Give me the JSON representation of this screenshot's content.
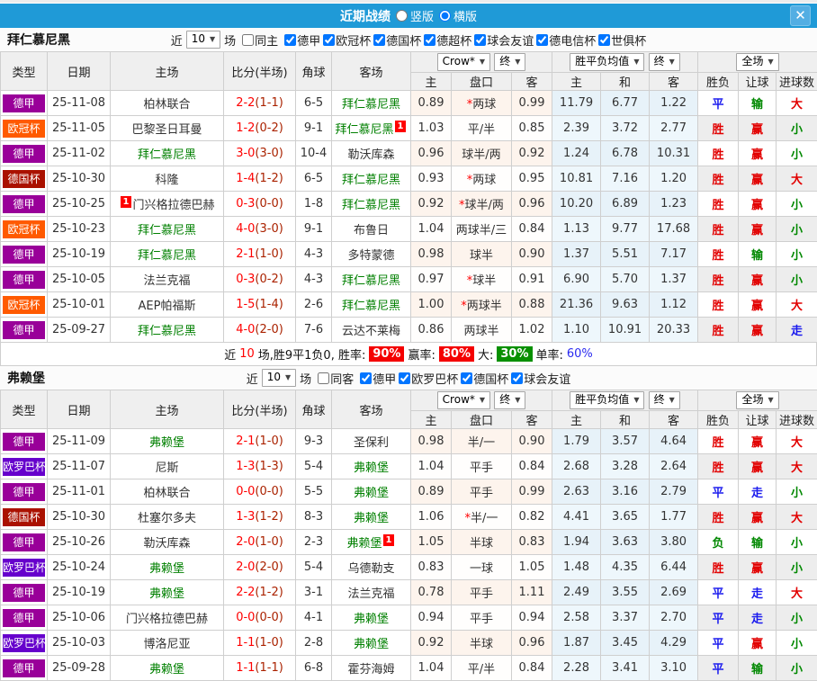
{
  "titlebar": {
    "title": "近期战绩",
    "vertical_label": "竖版",
    "horizontal_label": "横版"
  },
  "icons": {
    "caret_down": "▼",
    "close": "✕"
  },
  "accent_colors": {
    "titlebar_blue": "#1f9ad7",
    "close_button_blue": "#53aee3"
  },
  "league_colors": {
    "德甲": "#990099",
    "欧冠杯": "#ff5a00",
    "德国杯": "#aa1100",
    "欧罗巴杯": "#6600cc"
  },
  "result_colors": {
    "r": "#e20000",
    "b": "#1a1aee",
    "g": "#008800"
  },
  "table_headers": {
    "type": "类型",
    "date": "日期",
    "home": "主场",
    "score": "比分(半场)",
    "corners": "角球",
    "away": "客场",
    "ah_home": "主",
    "ah_line": "盘口",
    "ah_away": "客",
    "eu_home": "主",
    "eu_draw": "和",
    "eu_away": "客",
    "result": "胜负",
    "handicap": "让球",
    "goals": "进球数",
    "dd_bookmaker": "Crow*",
    "dd_final1": "终",
    "dd_avg": "胜平负均值",
    "dd_final2": "终",
    "dd_fulltime": "全场"
  },
  "sections": [
    {
      "team": "拜仁慕尼黑",
      "near_label": "近",
      "count": "10",
      "games_label": "场",
      "venue_label": "同主",
      "same_venue_checked": false,
      "leagues": [
        {
          "label": "德甲",
          "checked": true
        },
        {
          "label": "欧冠杯",
          "checked": true
        },
        {
          "label": "德国杯",
          "checked": true
        },
        {
          "label": "德超杯",
          "checked": true
        },
        {
          "label": "球会友谊",
          "checked": true
        },
        {
          "label": "德电信杯",
          "checked": true
        },
        {
          "label": "世俱杯",
          "checked": true
        }
      ],
      "rows": [
        {
          "lg": "德甲",
          "dt": "25-11-08",
          "hm": "柏林联合",
          "hmb": "",
          "sc": "2-2",
          "htm": "(1-1)",
          "cn": "6-5",
          "aw": "拜仁慕尼黑",
          "awb": "",
          "h": "0.89",
          "hc": "*两球",
          "a": "0.99",
          "o1": "11.79",
          "o2": "6.77",
          "o3": "1.22",
          "r1": [
            "平",
            "b"
          ],
          "r2": [
            "输",
            "g"
          ],
          "r3": [
            "大",
            "r"
          ]
        },
        {
          "lg": "欧冠杯",
          "dt": "25-11-05",
          "hm": "巴黎圣日耳曼",
          "hmb": "",
          "sc": "1-2",
          "htm": "(0-2)",
          "cn": "9-1",
          "aw": "拜仁慕尼黑",
          "awb": "1",
          "h": "1.03",
          "hc": "平/半",
          "a": "0.85",
          "o1": "2.39",
          "o2": "3.72",
          "o3": "2.77",
          "r1": [
            "胜",
            "r"
          ],
          "r2": [
            "赢",
            "r"
          ],
          "r3": [
            "小",
            "g"
          ]
        },
        {
          "lg": "德甲",
          "dt": "25-11-02",
          "hm": "拜仁慕尼黑",
          "hmb": "",
          "sc": "3-0",
          "htm": "(3-0)",
          "cn": "10-4",
          "aw": "勒沃库森",
          "awb": "",
          "h": "0.96",
          "hc": "球半/两",
          "a": "0.92",
          "o1": "1.24",
          "o2": "6.78",
          "o3": "10.31",
          "r1": [
            "胜",
            "r"
          ],
          "r2": [
            "赢",
            "r"
          ],
          "r3": [
            "小",
            "g"
          ]
        },
        {
          "lg": "德国杯",
          "dt": "25-10-30",
          "hm": "科隆",
          "hmb": "",
          "sc": "1-4",
          "htm": "(1-2)",
          "cn": "6-5",
          "aw": "拜仁慕尼黑",
          "awb": "",
          "h": "0.93",
          "hc": "*两球",
          "a": "0.95",
          "o1": "10.81",
          "o2": "7.16",
          "o3": "1.20",
          "r1": [
            "胜",
            "r"
          ],
          "r2": [
            "赢",
            "r"
          ],
          "r3": [
            "大",
            "r"
          ]
        },
        {
          "lg": "德甲",
          "dt": "25-10-25",
          "hm": "门兴格拉德巴赫",
          "hmb": "1",
          "sc": "0-3",
          "htm": "(0-0)",
          "cn": "1-8",
          "aw": "拜仁慕尼黑",
          "awb": "",
          "h": "0.92",
          "hc": "*球半/两",
          "a": "0.96",
          "o1": "10.20",
          "o2": "6.89",
          "o3": "1.23",
          "r1": [
            "胜",
            "r"
          ],
          "r2": [
            "赢",
            "r"
          ],
          "r3": [
            "小",
            "g"
          ]
        },
        {
          "lg": "欧冠杯",
          "dt": "25-10-23",
          "hm": "拜仁慕尼黑",
          "hmb": "",
          "sc": "4-0",
          "htm": "(3-0)",
          "cn": "9-1",
          "aw": "布鲁日",
          "awb": "",
          "h": "1.04",
          "hc": "两球半/三",
          "a": "0.84",
          "o1": "1.13",
          "o2": "9.77",
          "o3": "17.68",
          "r1": [
            "胜",
            "r"
          ],
          "r2": [
            "赢",
            "r"
          ],
          "r3": [
            "小",
            "g"
          ]
        },
        {
          "lg": "德甲",
          "dt": "25-10-19",
          "hm": "拜仁慕尼黑",
          "hmb": "",
          "sc": "2-1",
          "htm": "(1-0)",
          "cn": "4-3",
          "aw": "多特蒙德",
          "awb": "",
          "h": "0.98",
          "hc": "球半",
          "a": "0.90",
          "o1": "1.37",
          "o2": "5.51",
          "o3": "7.17",
          "r1": [
            "胜",
            "r"
          ],
          "r2": [
            "输",
            "g"
          ],
          "r3": [
            "小",
            "g"
          ]
        },
        {
          "lg": "德甲",
          "dt": "25-10-05",
          "hm": "法兰克福",
          "hmb": "",
          "sc": "0-3",
          "htm": "(0-2)",
          "cn": "4-3",
          "aw": "拜仁慕尼黑",
          "awb": "",
          "h": "0.97",
          "hc": "*球半",
          "a": "0.91",
          "o1": "6.90",
          "o2": "5.70",
          "o3": "1.37",
          "r1": [
            "胜",
            "r"
          ],
          "r2": [
            "赢",
            "r"
          ],
          "r3": [
            "小",
            "g"
          ]
        },
        {
          "lg": "欧冠杯",
          "dt": "25-10-01",
          "hm": "AEP帕福斯",
          "hmb": "",
          "sc": "1-5",
          "htm": "(1-4)",
          "cn": "2-6",
          "aw": "拜仁慕尼黑",
          "awb": "",
          "h": "1.00",
          "hc": "*两球半",
          "a": "0.88",
          "o1": "21.36",
          "o2": "9.63",
          "o3": "1.12",
          "r1": [
            "胜",
            "r"
          ],
          "r2": [
            "赢",
            "r"
          ],
          "r3": [
            "大",
            "r"
          ]
        },
        {
          "lg": "德甲",
          "dt": "25-09-27",
          "hm": "拜仁慕尼黑",
          "hmb": "",
          "sc": "4-0",
          "htm": "(2-0)",
          "cn": "7-6",
          "aw": "云达不莱梅",
          "awb": "",
          "h": "0.86",
          "hc": "两球半",
          "a": "1.02",
          "o1": "1.10",
          "o2": "10.91",
          "o3": "20.33",
          "r1": [
            "胜",
            "r"
          ],
          "r2": [
            "赢",
            "r"
          ],
          "r3": [
            "走",
            "b"
          ]
        }
      ],
      "summary": {
        "prefix": "近",
        "count": "10",
        "mid": "场,胜9平1负0, 胜率:",
        "win_rate": "90%",
        "asia_label": "赢率:",
        "asia_rate": "80%",
        "big_label": "大:",
        "big_rate": "30%",
        "single_label": "单率:",
        "single_rate": "60%"
      }
    },
    {
      "team": "弗赖堡",
      "near_label": "近",
      "count": "10",
      "games_label": "场",
      "venue_label": "同客",
      "same_venue_checked": false,
      "leagues": [
        {
          "label": "德甲",
          "checked": true
        },
        {
          "label": "欧罗巴杯",
          "checked": true
        },
        {
          "label": "德国杯",
          "checked": true
        },
        {
          "label": "球会友谊",
          "checked": true
        }
      ],
      "rows": [
        {
          "lg": "德甲",
          "dt": "25-11-09",
          "hm": "弗赖堡",
          "hmb": "",
          "sc": "2-1",
          "htm": "(1-0)",
          "cn": "9-3",
          "aw": "圣保利",
          "awb": "",
          "h": "0.98",
          "hc": "半/一",
          "a": "0.90",
          "o1": "1.79",
          "o2": "3.57",
          "o3": "4.64",
          "r1": [
            "胜",
            "r"
          ],
          "r2": [
            "赢",
            "r"
          ],
          "r3": [
            "大",
            "r"
          ]
        },
        {
          "lg": "欧罗巴杯",
          "dt": "25-11-07",
          "hm": "尼斯",
          "hmb": "",
          "sc": "1-3",
          "htm": "(1-3)",
          "cn": "5-4",
          "aw": "弗赖堡",
          "awb": "",
          "h": "1.04",
          "hc": "平手",
          "a": "0.84",
          "o1": "2.68",
          "o2": "3.28",
          "o3": "2.64",
          "r1": [
            "胜",
            "r"
          ],
          "r2": [
            "赢",
            "r"
          ],
          "r3": [
            "大",
            "r"
          ]
        },
        {
          "lg": "德甲",
          "dt": "25-11-01",
          "hm": "柏林联合",
          "hmb": "",
          "sc": "0-0",
          "htm": "(0-0)",
          "cn": "5-5",
          "aw": "弗赖堡",
          "awb": "",
          "h": "0.89",
          "hc": "平手",
          "a": "0.99",
          "o1": "2.63",
          "o2": "3.16",
          "o3": "2.79",
          "r1": [
            "平",
            "b"
          ],
          "r2": [
            "走",
            "b"
          ],
          "r3": [
            "小",
            "g"
          ]
        },
        {
          "lg": "德国杯",
          "dt": "25-10-30",
          "hm": "杜塞尔多夫",
          "hmb": "",
          "sc": "1-3",
          "htm": "(1-2)",
          "cn": "8-3",
          "aw": "弗赖堡",
          "awb": "",
          "h": "1.06",
          "hc": "*半/一",
          "a": "0.82",
          "o1": "4.41",
          "o2": "3.65",
          "o3": "1.77",
          "r1": [
            "胜",
            "r"
          ],
          "r2": [
            "赢",
            "r"
          ],
          "r3": [
            "大",
            "r"
          ]
        },
        {
          "lg": "德甲",
          "dt": "25-10-26",
          "hm": "勒沃库森",
          "hmb": "",
          "sc": "2-0",
          "htm": "(1-0)",
          "cn": "2-3",
          "aw": "弗赖堡",
          "awb": "1",
          "h": "1.05",
          "hc": "半球",
          "a": "0.83",
          "o1": "1.94",
          "o2": "3.63",
          "o3": "3.80",
          "r1": [
            "负",
            "g"
          ],
          "r2": [
            "输",
            "g"
          ],
          "r3": [
            "小",
            "g"
          ]
        },
        {
          "lg": "欧罗巴杯",
          "dt": "25-10-24",
          "hm": "弗赖堡",
          "hmb": "",
          "sc": "2-0",
          "htm": "(2-0)",
          "cn": "5-4",
          "aw": "乌德勒支",
          "awb": "",
          "h": "0.83",
          "hc": "一球",
          "a": "1.05",
          "o1": "1.48",
          "o2": "4.35",
          "o3": "6.44",
          "r1": [
            "胜",
            "r"
          ],
          "r2": [
            "赢",
            "r"
          ],
          "r3": [
            "小",
            "g"
          ]
        },
        {
          "lg": "德甲",
          "dt": "25-10-19",
          "hm": "弗赖堡",
          "hmb": "",
          "sc": "2-2",
          "htm": "(1-2)",
          "cn": "3-1",
          "aw": "法兰克福",
          "awb": "",
          "h": "0.78",
          "hc": "平手",
          "a": "1.11",
          "o1": "2.49",
          "o2": "3.55",
          "o3": "2.69",
          "r1": [
            "平",
            "b"
          ],
          "r2": [
            "走",
            "b"
          ],
          "r3": [
            "大",
            "r"
          ]
        },
        {
          "lg": "德甲",
          "dt": "25-10-06",
          "hm": "门兴格拉德巴赫",
          "hmb": "",
          "sc": "0-0",
          "htm": "(0-0)",
          "cn": "4-1",
          "aw": "弗赖堡",
          "awb": "",
          "h": "0.94",
          "hc": "平手",
          "a": "0.94",
          "o1": "2.58",
          "o2": "3.37",
          "o3": "2.70",
          "r1": [
            "平",
            "b"
          ],
          "r2": [
            "走",
            "b"
          ],
          "r3": [
            "小",
            "g"
          ]
        },
        {
          "lg": "欧罗巴杯",
          "dt": "25-10-03",
          "hm": "博洛尼亚",
          "hmb": "",
          "sc": "1-1",
          "htm": "(1-0)",
          "cn": "2-8",
          "aw": "弗赖堡",
          "awb": "",
          "h": "0.92",
          "hc": "半球",
          "a": "0.96",
          "o1": "1.87",
          "o2": "3.45",
          "o3": "4.29",
          "r1": [
            "平",
            "b"
          ],
          "r2": [
            "赢",
            "r"
          ],
          "r3": [
            "小",
            "g"
          ]
        },
        {
          "lg": "德甲",
          "dt": "25-09-28",
          "hm": "弗赖堡",
          "hmb": "",
          "sc": "1-1",
          "htm": "(1-1)",
          "cn": "6-8",
          "aw": "霍芬海姆",
          "awb": "",
          "h": "1.04",
          "hc": "平/半",
          "a": "0.84",
          "o1": "2.28",
          "o2": "3.41",
          "o3": "3.10",
          "r1": [
            "平",
            "b"
          ],
          "r2": [
            "输",
            "g"
          ],
          "r3": [
            "小",
            "g"
          ]
        }
      ],
      "summary": null
    }
  ]
}
